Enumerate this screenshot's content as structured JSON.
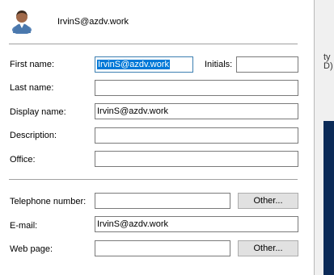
{
  "header": {
    "user_name": "IrvinS@azdv.work",
    "avatar_icon": "user-icon"
  },
  "form": {
    "first_name": {
      "label": "First name:",
      "value": "IrvinS@azdv.work"
    },
    "initials": {
      "label": "Initials:",
      "value": ""
    },
    "last_name": {
      "label": "Last name:",
      "value": ""
    },
    "display_name": {
      "label": "Display name:",
      "value": "IrvinS@azdv.work"
    },
    "description": {
      "label": "Description:",
      "value": ""
    },
    "office": {
      "label": "Office:",
      "value": ""
    },
    "telephone": {
      "label": "Telephone number:",
      "value": "",
      "other_label": "Other..."
    },
    "email": {
      "label": "E-mail:",
      "value": "IrvinS@azdv.work"
    },
    "web_page": {
      "label": "Web page:",
      "value": "",
      "other_label": "Other..."
    }
  },
  "background_window": {
    "partial_text_1": "ty",
    "partial_text_2": "D)"
  },
  "colors": {
    "selection": "#0078d7",
    "focus_border": "#3c7fb1",
    "background_dark": "#0b2a57"
  }
}
